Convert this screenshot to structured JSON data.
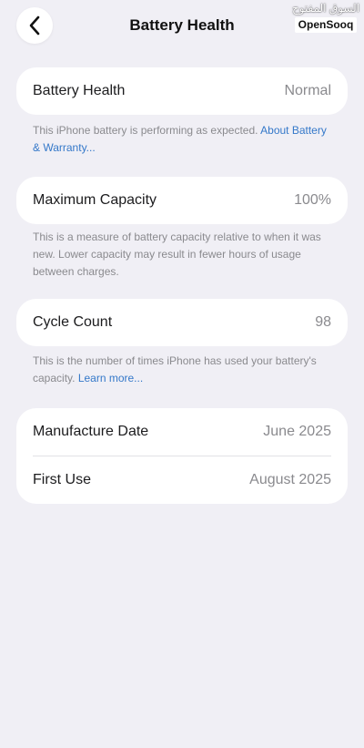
{
  "header": {
    "title": "Battery Health"
  },
  "watermark": {
    "arabic": "السوق المفتوح",
    "latin": "OpenSooq"
  },
  "battery_health": {
    "label": "Battery Health",
    "value": "Normal",
    "note": "This iPhone battery is performing as expected.",
    "link": "About Battery & Warranty..."
  },
  "maximum_capacity": {
    "label": "Maximum Capacity",
    "value": "100%",
    "note": "This is a measure of battery capacity relative to when it was new. Lower capacity may result in fewer hours of usage between charges."
  },
  "cycle_count": {
    "label": "Cycle Count",
    "value": "98",
    "note": "This is the number of times iPhone has used your battery's capacity.",
    "link": "Learn more..."
  },
  "dates": {
    "manufacture_label": "Manufacture Date",
    "manufacture_value": "June 2025",
    "first_use_label": "First Use",
    "first_use_value": "August 2025"
  },
  "colors": {
    "background": "#f0eff5",
    "card": "#ffffff",
    "link": "#3478c9",
    "secondary_text": "#8a8a8e"
  },
  "icons": {
    "back": "chevron-left-icon"
  }
}
